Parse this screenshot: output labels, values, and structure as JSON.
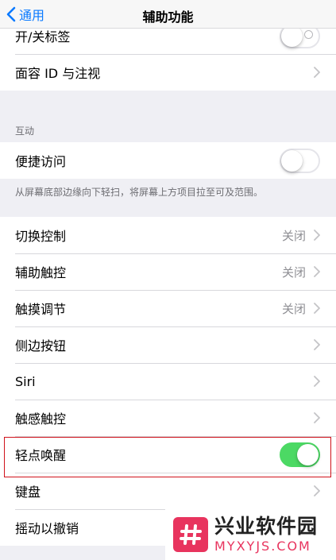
{
  "navbar": {
    "back_label": "通用",
    "title": "辅助功能"
  },
  "top_group": {
    "partial_row_label": "开/关标签",
    "face_id_label": "面容 ID 与注视"
  },
  "interaction": {
    "header": "互动",
    "reachability_label": "便捷访问",
    "reachability_on": false,
    "footer": "从屏幕底部边缘向下轻扫，将屏幕上方项目拉至可及范围。"
  },
  "rows": [
    {
      "label": "切换控制",
      "value": "关闭",
      "type": "chevron"
    },
    {
      "label": "辅助触控",
      "value": "关闭",
      "type": "chevron"
    },
    {
      "label": "触摸调节",
      "value": "关闭",
      "type": "chevron"
    },
    {
      "label": "侧边按钮",
      "value": "",
      "type": "chevron"
    },
    {
      "label": "Siri",
      "value": "",
      "type": "chevron"
    },
    {
      "label": "触感触控",
      "value": "",
      "type": "chevron"
    },
    {
      "label": "轻点唤醒",
      "value": "",
      "type": "toggle",
      "on": true
    },
    {
      "label": "键盘",
      "value": "",
      "type": "chevron"
    },
    {
      "label": "摇动以撤销",
      "value": "",
      "type": "chevron"
    }
  ],
  "watermark": {
    "name": "兴业软件园",
    "url": "MYXYJS.COM"
  },
  "colors": {
    "accent": "#0a7aff",
    "toggle_on": "#4cd964",
    "highlight": "#d0121b",
    "background": "#efeff4"
  }
}
